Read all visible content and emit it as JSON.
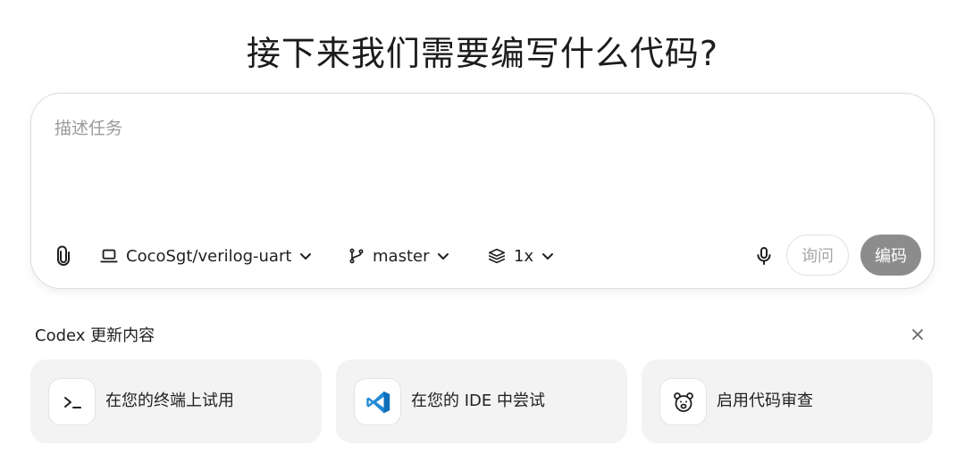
{
  "headline": "接下来我们需要编写什么代码?",
  "composer": {
    "placeholder": "描述任务",
    "repo": "CocoSgt/verilog-uart",
    "branch": "master",
    "count": "1x",
    "ask_label": "询问",
    "code_label": "编码"
  },
  "updates": {
    "title": "Codex 更新内容",
    "cards": [
      {
        "label": "在您的终端上试用",
        "icon": "terminal-icon"
      },
      {
        "label": "在您的 IDE 中尝试",
        "icon": "vscode-icon"
      },
      {
        "label": "启用代码审查",
        "icon": "code-review-bear-icon"
      }
    ]
  },
  "colors": {
    "code_button_bg": "#8c8c8c",
    "vscode_blue": "#1e8ad6",
    "card_bg": "#f3f3f3"
  }
}
